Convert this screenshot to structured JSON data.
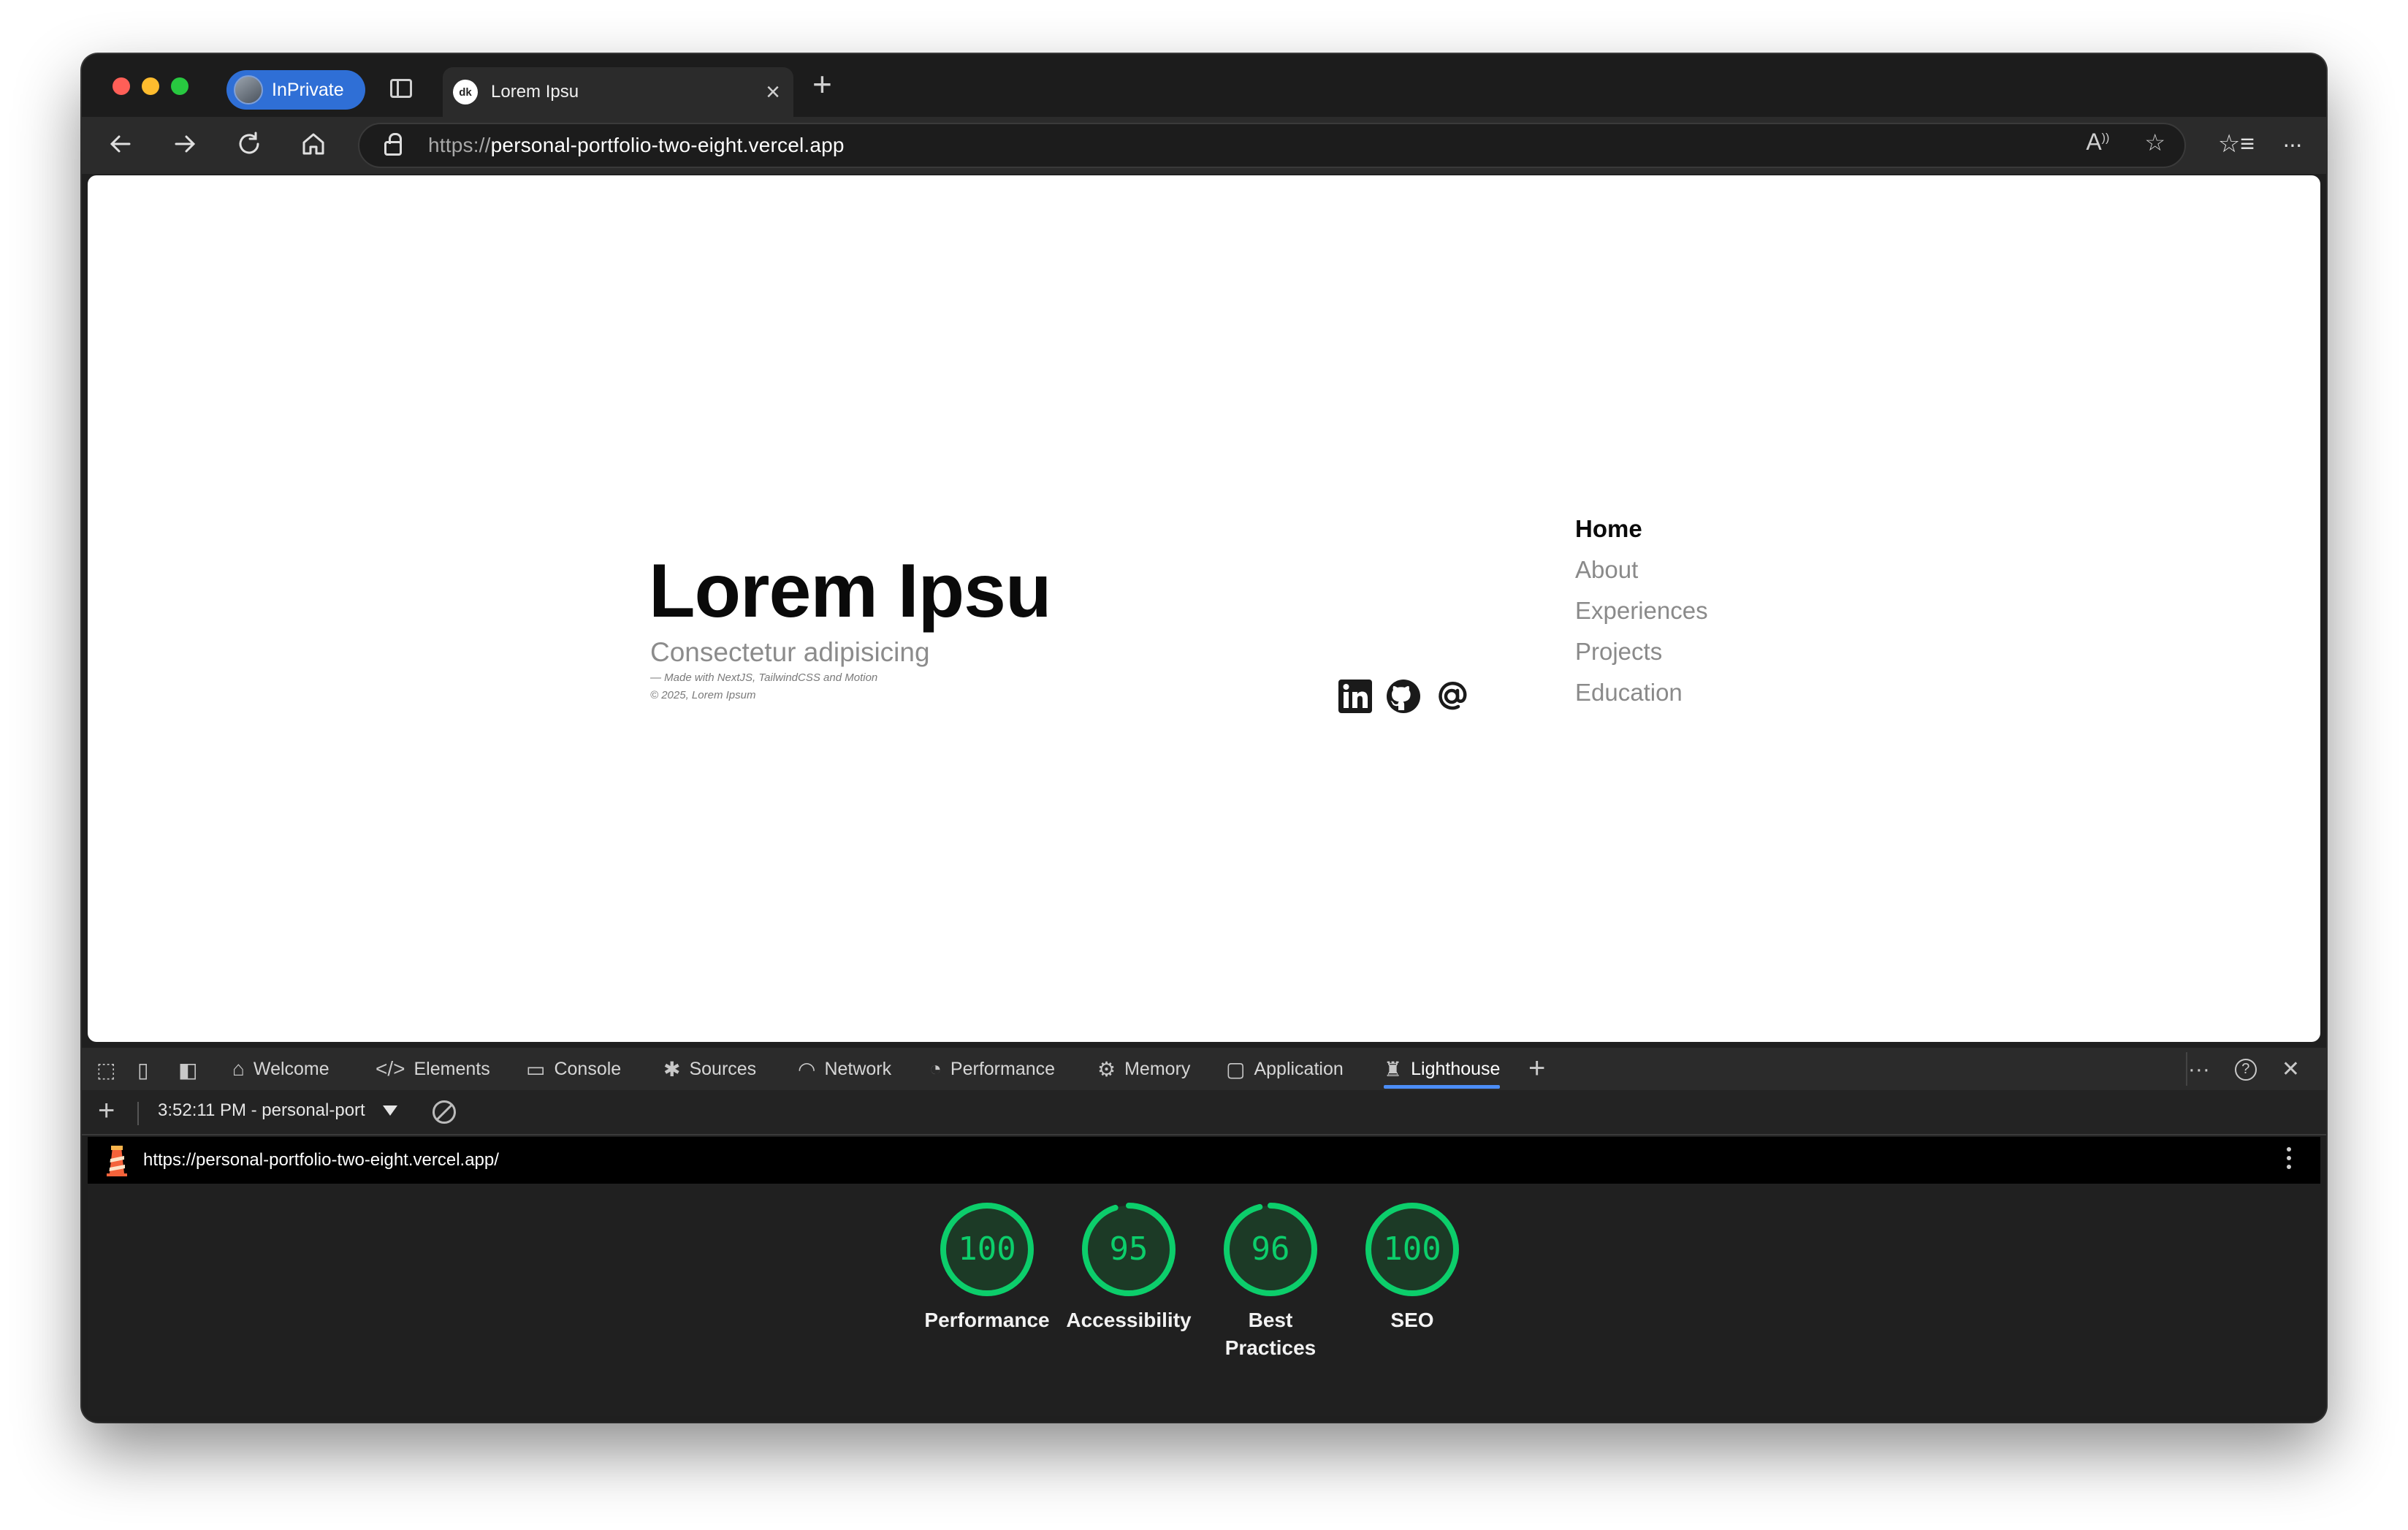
{
  "browser": {
    "profile_label": "InPrivate",
    "tab_title": "Lorem Ipsu",
    "favicon_text": "dk",
    "url_scheme": "https://",
    "url_host": "personal-portfolio-two-eight.vercel.app"
  },
  "page": {
    "title": "Lorem Ipsu",
    "subtitle": "Consectetur adipisicing",
    "credit_line_1": "— Made with NextJS, TailwindCSS and Motion",
    "credit_line_2": "© 2025, Lorem Ipsum",
    "socials": [
      "linkedin-icon",
      "github-icon",
      "at-sign-icon"
    ],
    "nav": [
      {
        "label": "Home",
        "active": true
      },
      {
        "label": "About",
        "active": false
      },
      {
        "label": "Experiences",
        "active": false
      },
      {
        "label": "Projects",
        "active": false
      },
      {
        "label": "Education",
        "active": false
      }
    ]
  },
  "devtools": {
    "tabs": [
      {
        "label": "Welcome",
        "icon": "home-icon"
      },
      {
        "label": "Elements",
        "icon": "code-icon"
      },
      {
        "label": "Console",
        "icon": "console-icon"
      },
      {
        "label": "Sources",
        "icon": "bug-icon"
      },
      {
        "label": "Network",
        "icon": "wifi-icon"
      },
      {
        "label": "Performance",
        "icon": "speedometer-icon"
      },
      {
        "label": "Memory",
        "icon": "chip-icon"
      },
      {
        "label": "Application",
        "icon": "window-icon"
      },
      {
        "label": "Lighthouse",
        "icon": "lighthouse-icon"
      }
    ],
    "active_tab": "Lighthouse",
    "report_selector": "3:52:11 PM - personal-port",
    "report_url": "https://personal-portfolio-two-eight.vercel.app/",
    "scores": [
      {
        "label": "Performance",
        "value": 100
      },
      {
        "label": "Accessibility",
        "value": 95
      },
      {
        "label": "Best Practices",
        "value": 96
      },
      {
        "label": "SEO",
        "value": 100
      }
    ],
    "score_color": "#0cce6b"
  }
}
